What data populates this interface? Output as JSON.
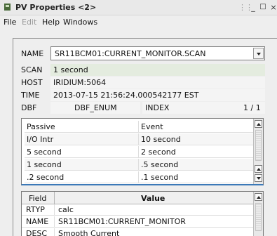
{
  "window": {
    "title": "PV Properties <2>",
    "controls": {
      "dots": "⋮⋮",
      "minimize": "_",
      "maximize": "□",
      "close": "×"
    }
  },
  "menubar": {
    "file": "File",
    "edit": "Edit",
    "help": "Help",
    "windows": "Windows"
  },
  "properties": {
    "name_label": "NAME",
    "name_value": "SR11BCM01:CURRENT_MONITOR.SCAN",
    "scan_label": "SCAN",
    "scan_value": "1 second",
    "host_label": "HOST",
    "host_value": "IRIDIUM:5064",
    "time_label": "TIME",
    "time_value": "2013-07-15 21:56:24.000542177  EST",
    "dbf_label": "DBF",
    "dbf_value": "DBF_ENUM",
    "index_label": "INDEX",
    "index_value": "1 / 1"
  },
  "scan_options": {
    "rows": [
      [
        "Passive",
        "Event"
      ],
      [
        "I/O Intr",
        "10 second"
      ],
      [
        "5 second",
        "2 second"
      ],
      [
        "1 second",
        ".5 second"
      ],
      [
        ".2 second",
        ".1 second"
      ]
    ]
  },
  "fields_table": {
    "columns": [
      "Field",
      "Value"
    ],
    "rows": [
      [
        "RTYP",
        "calc"
      ],
      [
        "NAME",
        "SR11BCM01:CURRENT_MONITOR"
      ],
      [
        "DESC",
        "Smooth Current"
      ]
    ]
  },
  "colors": {
    "scan_highlight": "#e4ecdf",
    "list_focus_border": "#3b79b8"
  }
}
